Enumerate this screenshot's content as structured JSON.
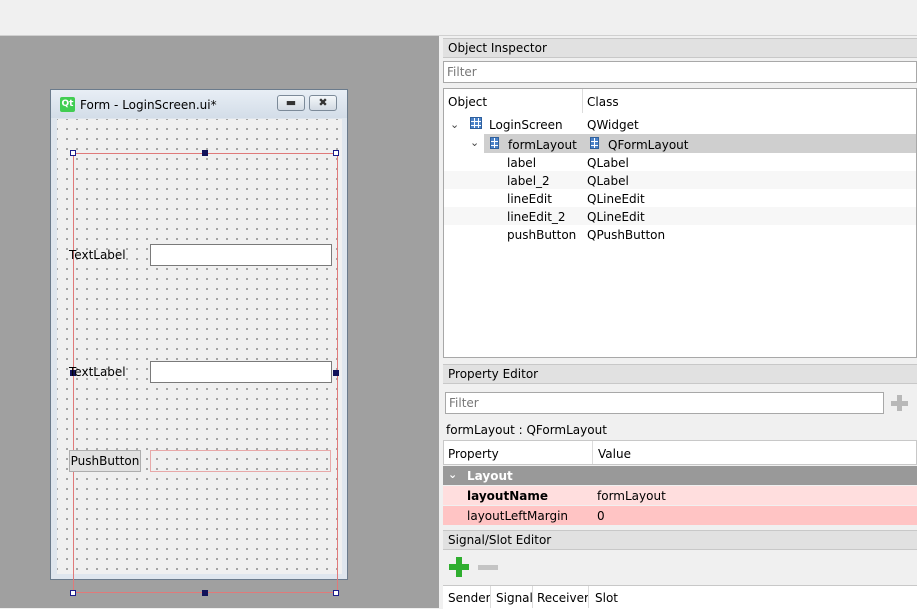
{
  "form_window": {
    "icon_text": "Qt",
    "title": "Form - LoginScreen.ui*",
    "label1": "TextLabel",
    "label2": "TextLabel",
    "push_button": "PushButton"
  },
  "object_inspector": {
    "title": "Object Inspector",
    "filter_placeholder": "Filter",
    "col_object": "Object",
    "col_class": "Class",
    "rows": [
      {
        "object": "LoginScreen",
        "class": "QWidget"
      },
      {
        "object": "formLayout",
        "class": "QFormLayout"
      },
      {
        "object": "label",
        "class": "QLabel"
      },
      {
        "object": "label_2",
        "class": "QLabel"
      },
      {
        "object": "lineEdit",
        "class": "QLineEdit"
      },
      {
        "object": "lineEdit_2",
        "class": "QLineEdit"
      },
      {
        "object": "pushButton",
        "class": "QPushButton"
      }
    ]
  },
  "property_editor": {
    "title": "Property Editor",
    "filter_placeholder": "Filter",
    "object_caption": "formLayout : QFormLayout",
    "col_property": "Property",
    "col_value": "Value",
    "group": "Layout",
    "props": [
      {
        "name": "layoutName",
        "value": "formLayout"
      },
      {
        "name": "layoutLeftMargin",
        "value": "0"
      }
    ]
  },
  "signal_slot_editor": {
    "title": "Signal/Slot Editor",
    "col_sender": "Sender",
    "col_signal": "Signal",
    "col_receiver": "Receiver",
    "col_slot": "Slot"
  },
  "colors": {
    "canvas_bg": "#a0a0a0",
    "selection_row": "#cfcfcf",
    "group_row": "#999999",
    "changed_prop_light": "#ffdede",
    "changed_prop_dark": "#ffc4c4",
    "add_green": "#2fae2f"
  }
}
